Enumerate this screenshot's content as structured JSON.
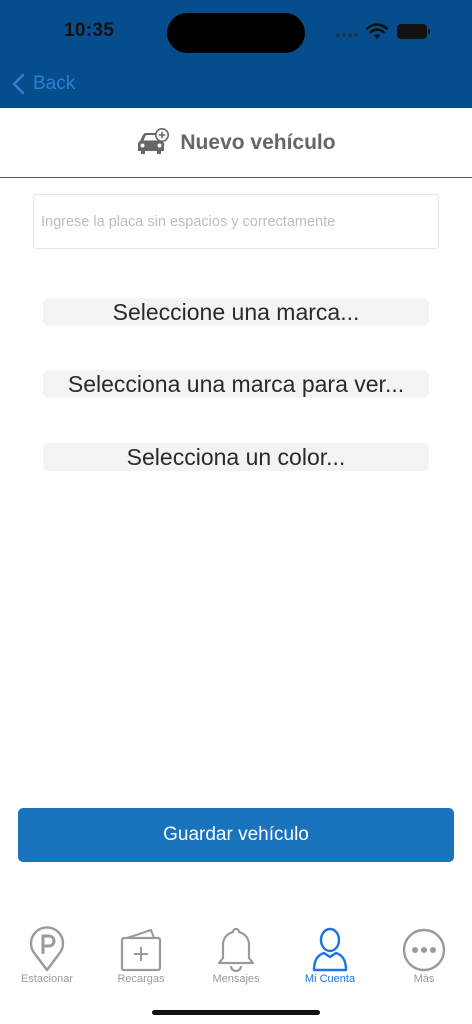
{
  "status": {
    "time": "10:35"
  },
  "nav": {
    "back_label": "Back"
  },
  "header": {
    "title": "Nuevo vehículo",
    "icon": "car-add-icon"
  },
  "form": {
    "plate_placeholder": "Ingrese la placa sin espacios y correctamente",
    "plate_value": "",
    "brand_picker": "Seleccione una marca...",
    "model_picker": "Selecciona una marca para ver...",
    "color_picker": "Selecciona un color..."
  },
  "actions": {
    "save_label": "Guardar vehículo"
  },
  "tabs": [
    {
      "label": "Estacionar",
      "icon": "parking-pin-icon",
      "active": false
    },
    {
      "label": "Recargas",
      "icon": "wallet-add-icon",
      "active": false
    },
    {
      "label": "Mensajes",
      "icon": "bell-icon",
      "active": false
    },
    {
      "label": "Mi Cuenta",
      "icon": "user-icon",
      "active": true
    },
    {
      "label": "Más",
      "icon": "more-icon",
      "active": false
    }
  ],
  "colors": {
    "nav_bar": "#054d8c",
    "back_link": "#2f7fd0",
    "primary_button": "#1a73bd",
    "tab_active": "#1a73e8",
    "tab_inactive": "#9a9a9a"
  }
}
